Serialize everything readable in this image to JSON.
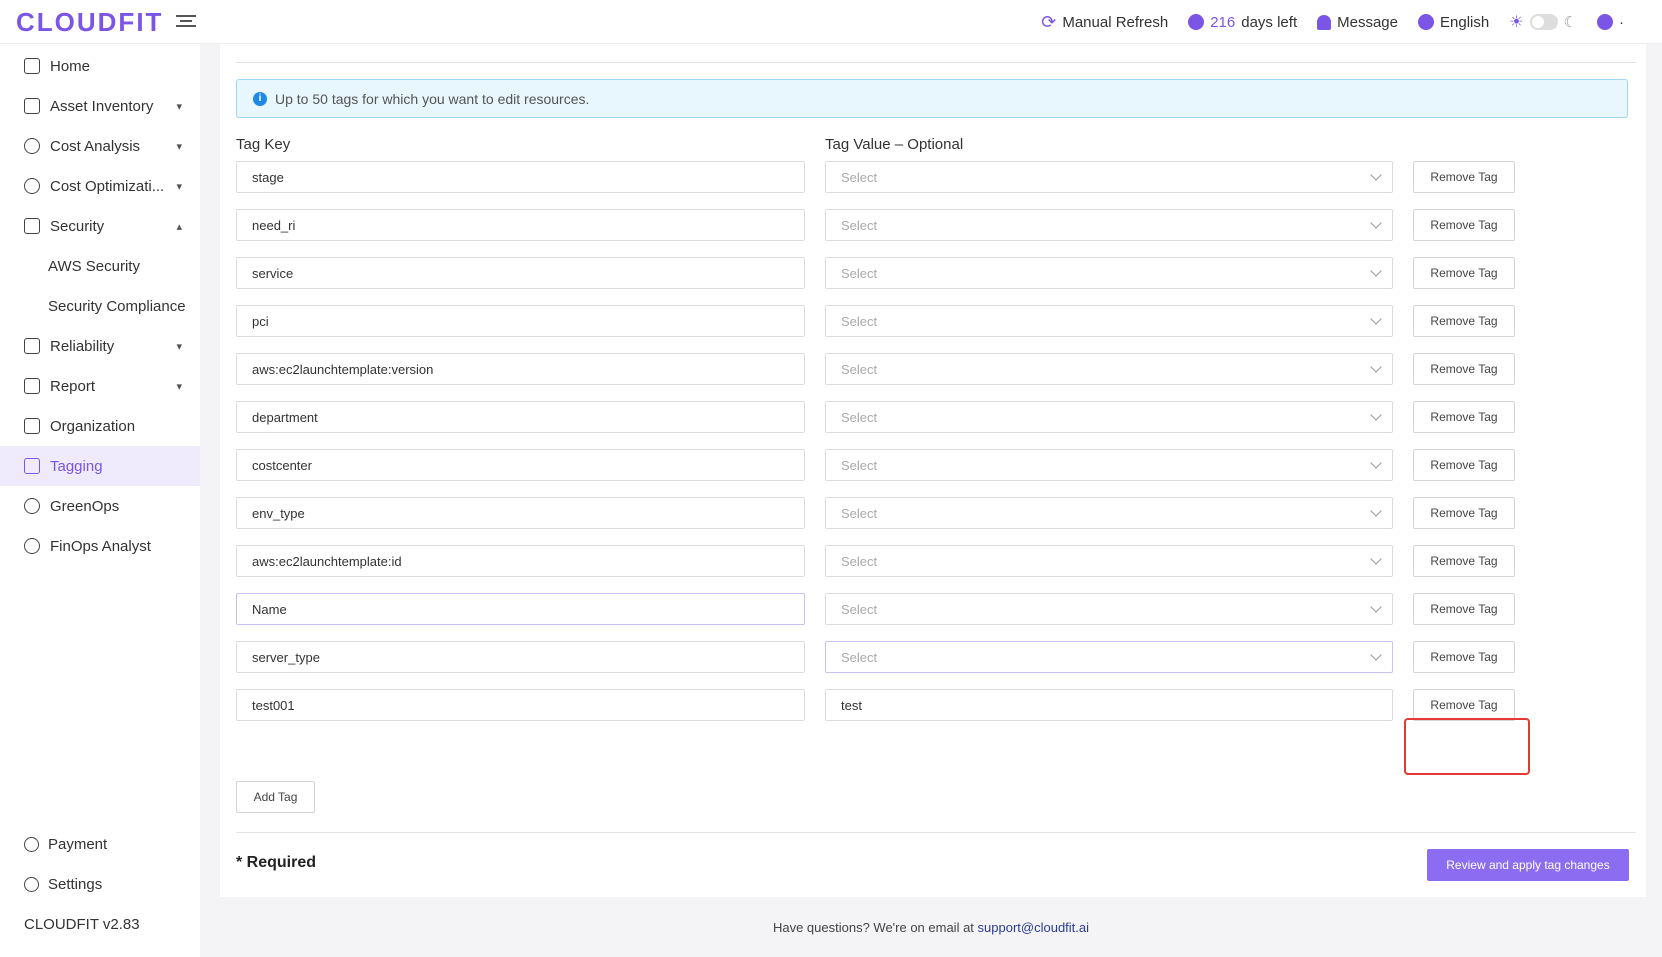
{
  "app": {
    "logo": "CLOUDFIT",
    "version": "CLOUDFIT v2.83"
  },
  "topnav": {
    "refresh": "Manual Refresh",
    "days_num": "216",
    "days_text": "days left",
    "message": "Message",
    "language": "English",
    "user": "·"
  },
  "sidebar": {
    "items": [
      {
        "label": "Home"
      },
      {
        "label": "Asset Inventory"
      },
      {
        "label": "Cost Analysis"
      },
      {
        "label": "Cost Optimizati..."
      },
      {
        "label": "Security"
      },
      {
        "label": "AWS Security"
      },
      {
        "label": "Security Compliance"
      },
      {
        "label": "Reliability"
      },
      {
        "label": "Report"
      },
      {
        "label": "Organization"
      },
      {
        "label": "Tagging"
      },
      {
        "label": "GreenOps"
      },
      {
        "label": "FinOps Analyst"
      }
    ],
    "payment": "Payment",
    "settings": "Settings"
  },
  "main": {
    "info": "Up to 50 tags for which you want to edit resources.",
    "tag_key_label": "Tag Key",
    "tag_value_label": "Tag Value – Optional",
    "value_placeholder": "Select",
    "remove_label": "Remove Tag",
    "rows": [
      {
        "key": "stage",
        "value": "Select"
      },
      {
        "key": "need_ri",
        "value": "Select"
      },
      {
        "key": "service",
        "value": "Select"
      },
      {
        "key": "pci",
        "value": "Select"
      },
      {
        "key": "aws:ec2launchtemplate:version",
        "value": "Select"
      },
      {
        "key": "department",
        "value": "Select"
      },
      {
        "key": "costcenter",
        "value": "Select"
      },
      {
        "key": "env_type",
        "value": "Select"
      },
      {
        "key": "aws:ec2launchtemplate:id",
        "value": "Select"
      },
      {
        "key": "Name",
        "value": "Select"
      },
      {
        "key": "server_type",
        "value": "Select"
      },
      {
        "key": "test001",
        "value": "test"
      }
    ],
    "add_tag": "Add Tag",
    "required": "* Required",
    "apply": "Review and apply tag changes"
  },
  "footer": {
    "text": "Have questions? We're on email at",
    "email": "support@cloudfit.ai"
  },
  "colors": {
    "accent": "#7b55e6",
    "highlight": "#e53935"
  }
}
